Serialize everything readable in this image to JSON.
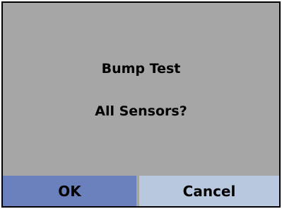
{
  "dialog": {
    "message_line1": "Bump Test",
    "message_line2": "All Sensors?"
  },
  "buttons": {
    "ok_label": "OK",
    "cancel_label": "Cancel"
  },
  "colors": {
    "dialog_background": "#a6a6a6",
    "ok_button": "#6a81bd",
    "cancel_button": "#b8c8df",
    "border": "#000000"
  }
}
